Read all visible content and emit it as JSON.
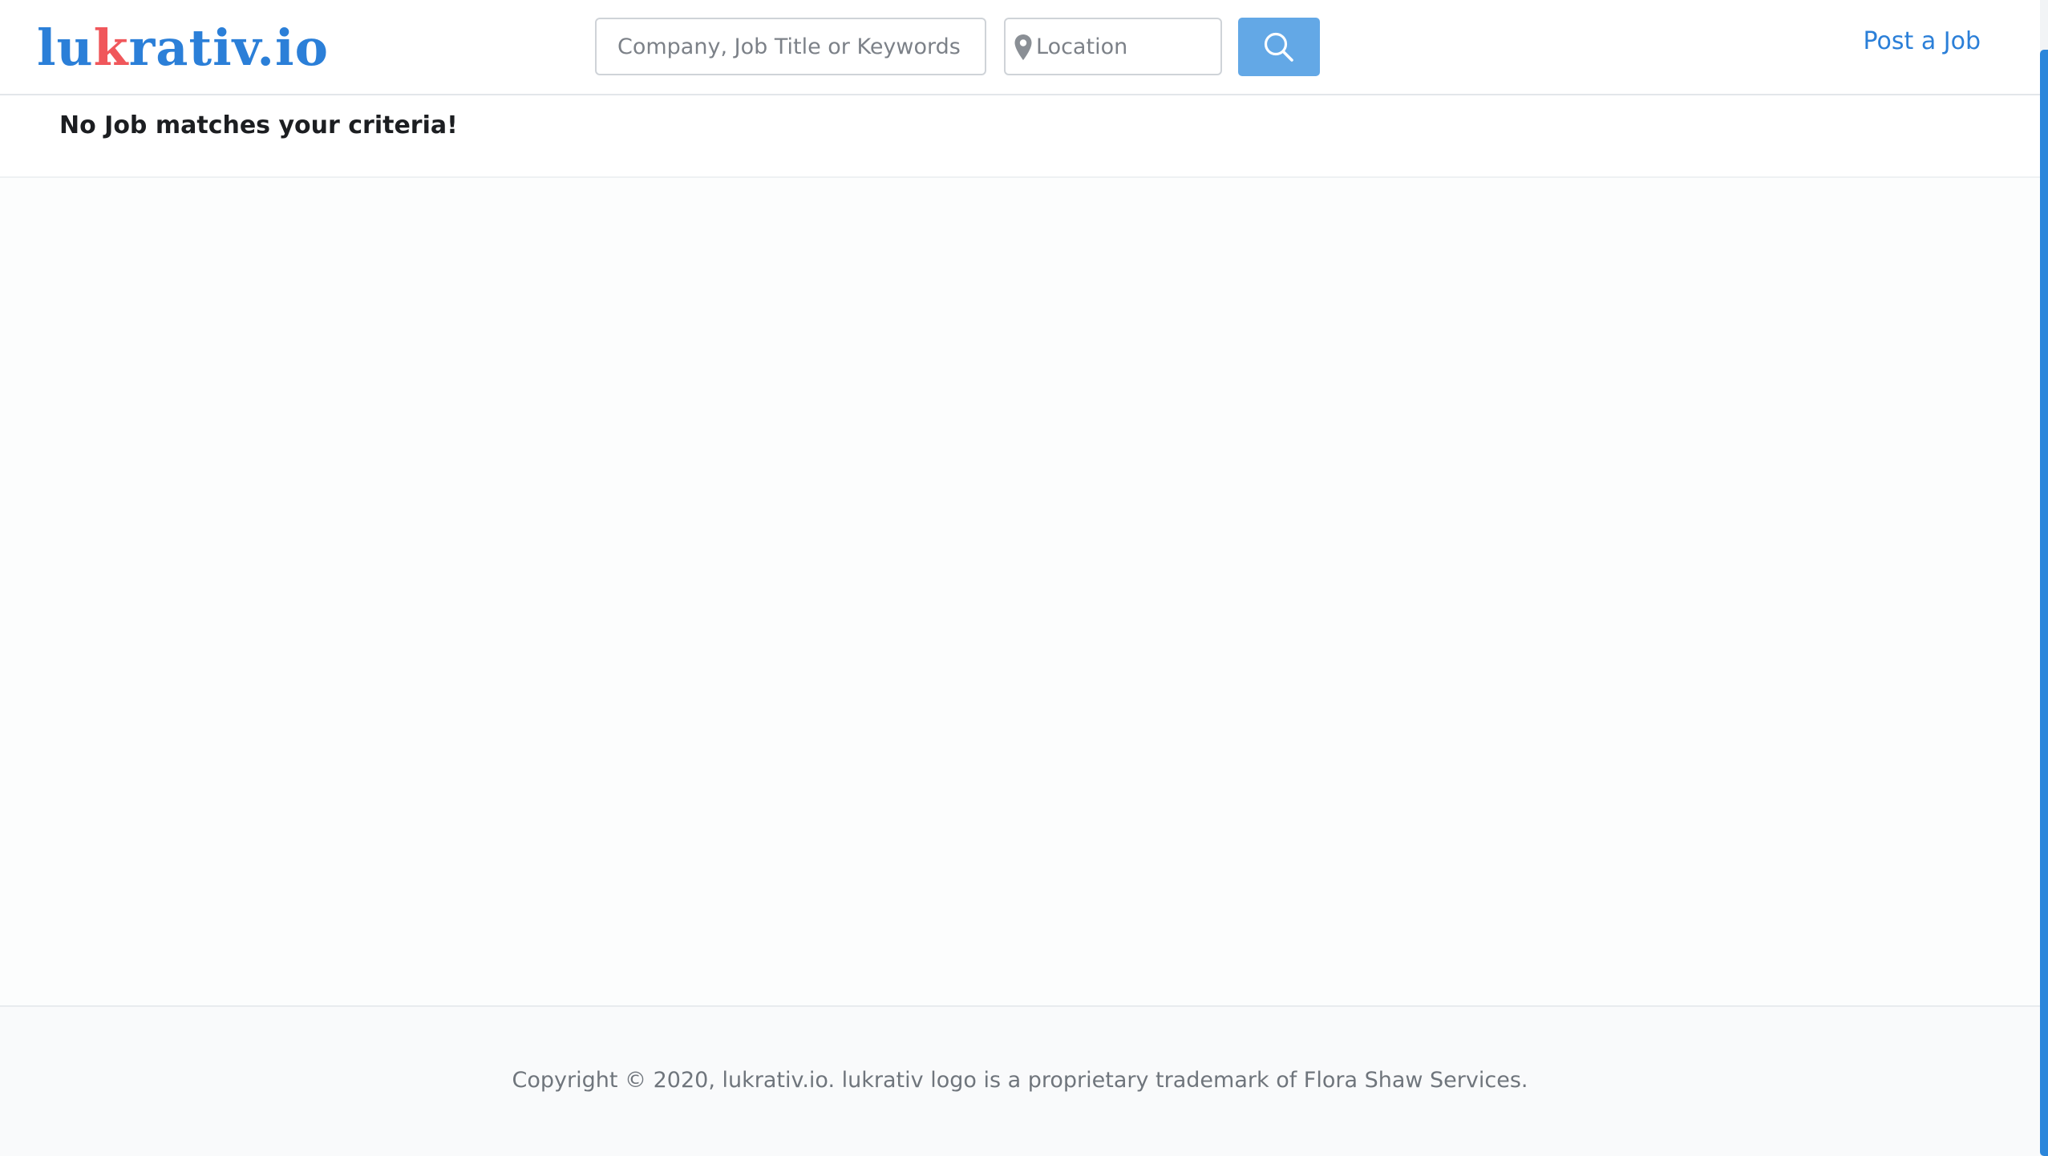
{
  "header": {
    "logo": {
      "part1": "lu",
      "accent": "k",
      "part2": "rativ.io"
    },
    "search": {
      "placeholder": "Company, Job Title or Keywords",
      "value": ""
    },
    "location": {
      "placeholder": "Location",
      "value": ""
    },
    "search_button": {
      "icon": "search-icon"
    },
    "post_job_label": "Post a Job"
  },
  "results": {
    "message": "No Job matches your criteria!"
  },
  "footer": {
    "copyright": "Copyright © 2020, lukrativ.io. lukrativ logo is a proprietary trademark of Flora Shaw Services."
  },
  "colors": {
    "brand_blue": "#2b7fd8",
    "brand_accent_red": "#f0575b",
    "search_button": "#63a8e6"
  }
}
